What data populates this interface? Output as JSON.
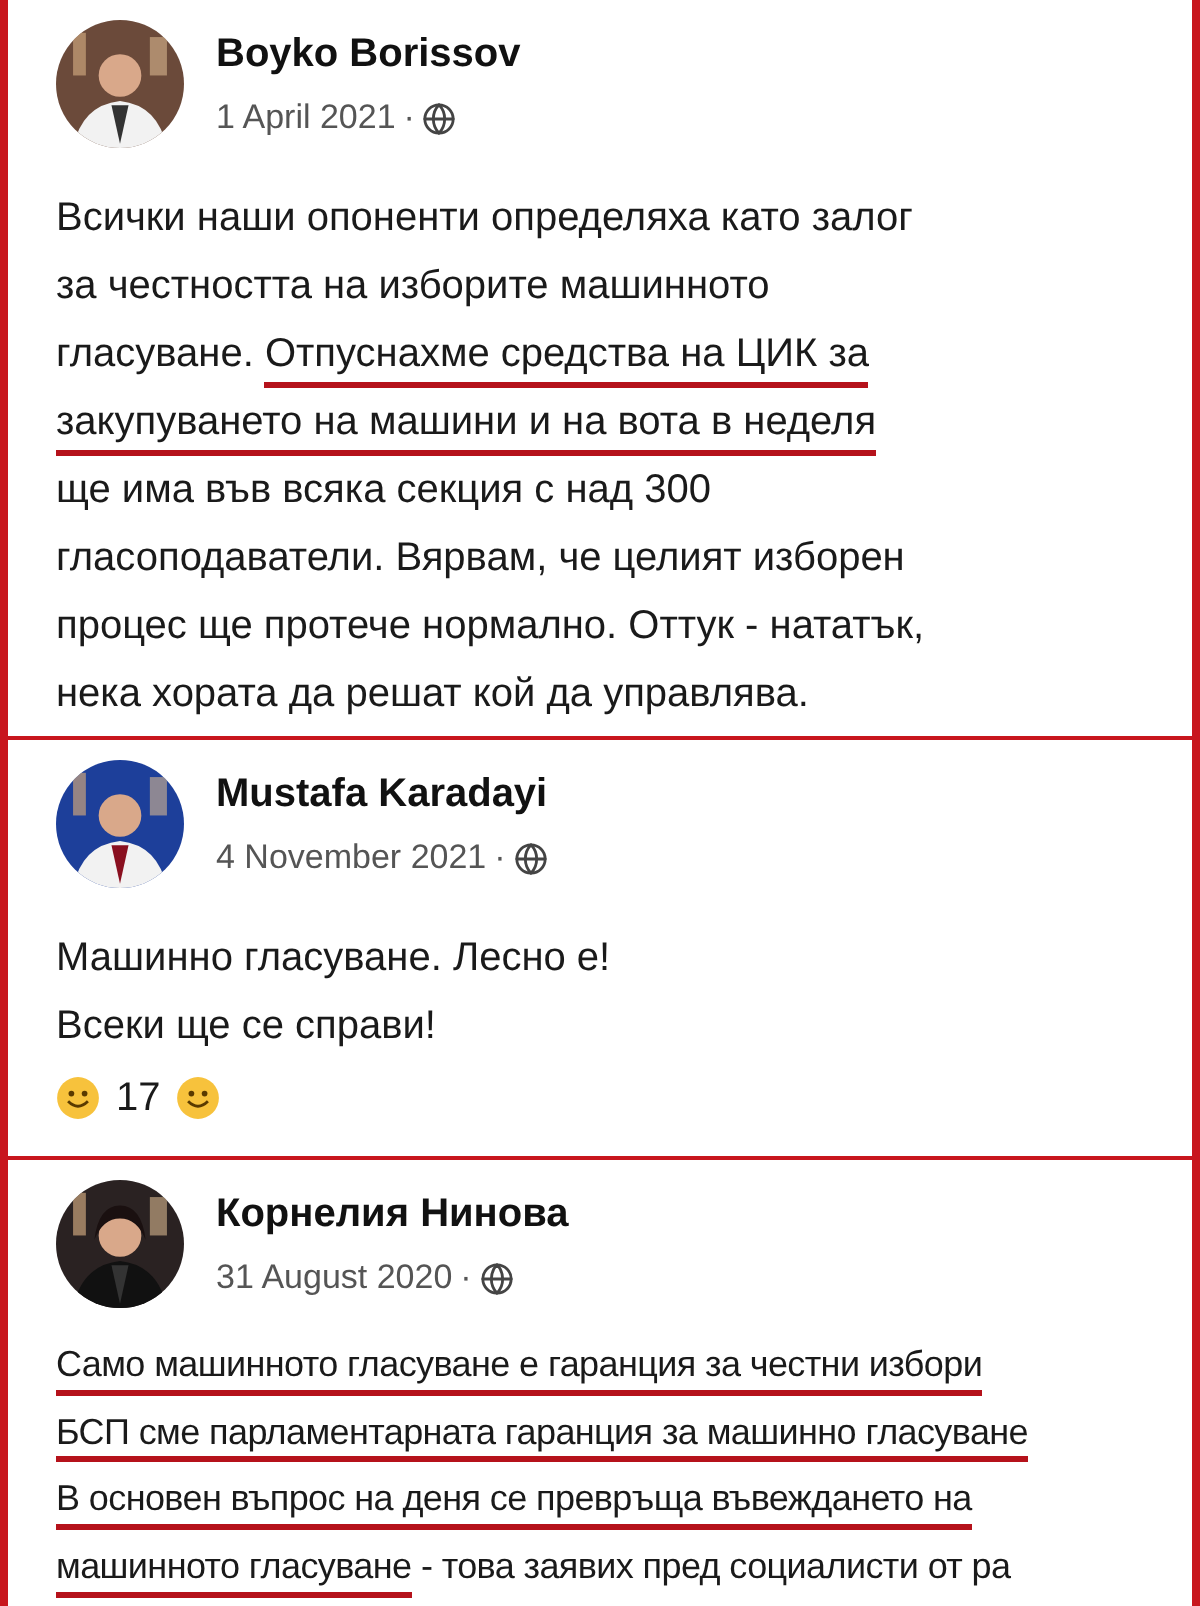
{
  "posts": [
    {
      "author": "Boyko Borissov",
      "date": "1 April 2021",
      "separator": "·",
      "lines": [
        [
          {
            "text": "Всички наши опоненти определяха като залог",
            "underlined": false
          }
        ],
        [
          {
            "text": "за честността на изборите машинното",
            "underlined": false
          }
        ],
        [
          {
            "text": "гласуване. ",
            "underlined": false
          },
          {
            "text": "Отпуснахме средства на ЦИК за",
            "underlined": true
          }
        ],
        [
          {
            "text": "закупуването на машини и на вота в неделя",
            "underlined": true
          }
        ],
        [
          {
            "text": "ще има във всяка секция с над 300",
            "underlined": false
          }
        ],
        [
          {
            "text": "гласоподаватели. Вярвам, че целият изборен",
            "underlined": false
          }
        ],
        [
          {
            "text": "процес ще протече нормално. Оттук - нататък,",
            "underlined": false
          }
        ],
        [
          {
            "text": "нека хората да решат кой да управлява.",
            "underlined": false
          }
        ]
      ]
    },
    {
      "author": "Mustafa Karadayi",
      "date": "4 November 2021",
      "separator": "·",
      "lines": [
        [
          {
            "text": "Машинно гласуване. Лесно е!",
            "underlined": false
          }
        ],
        [
          {
            "text": "Всеки ще се справи!",
            "underlined": false
          }
        ]
      ],
      "reaction": {
        "count": "17"
      }
    },
    {
      "author": "Корнелия Нинова",
      "date": "31 August 2020",
      "separator": "·",
      "lines": [
        [
          {
            "text": "Само машинното гласуване е гаранция за честни избори",
            "underlined": true
          }
        ],
        [
          {
            "text": "БСП сме парламентарната гаранция за машинно гласуване",
            "underlined": true
          }
        ],
        [
          {
            "text": "В основен въпрос на деня се превръща въвеждането на",
            "underlined": true
          }
        ],
        [
          {
            "text": "машинното гласуване",
            "underlined": true
          },
          {
            "text": " - това заявих пред социалисти от ра",
            "underlined": false
          }
        ]
      ]
    }
  ]
}
